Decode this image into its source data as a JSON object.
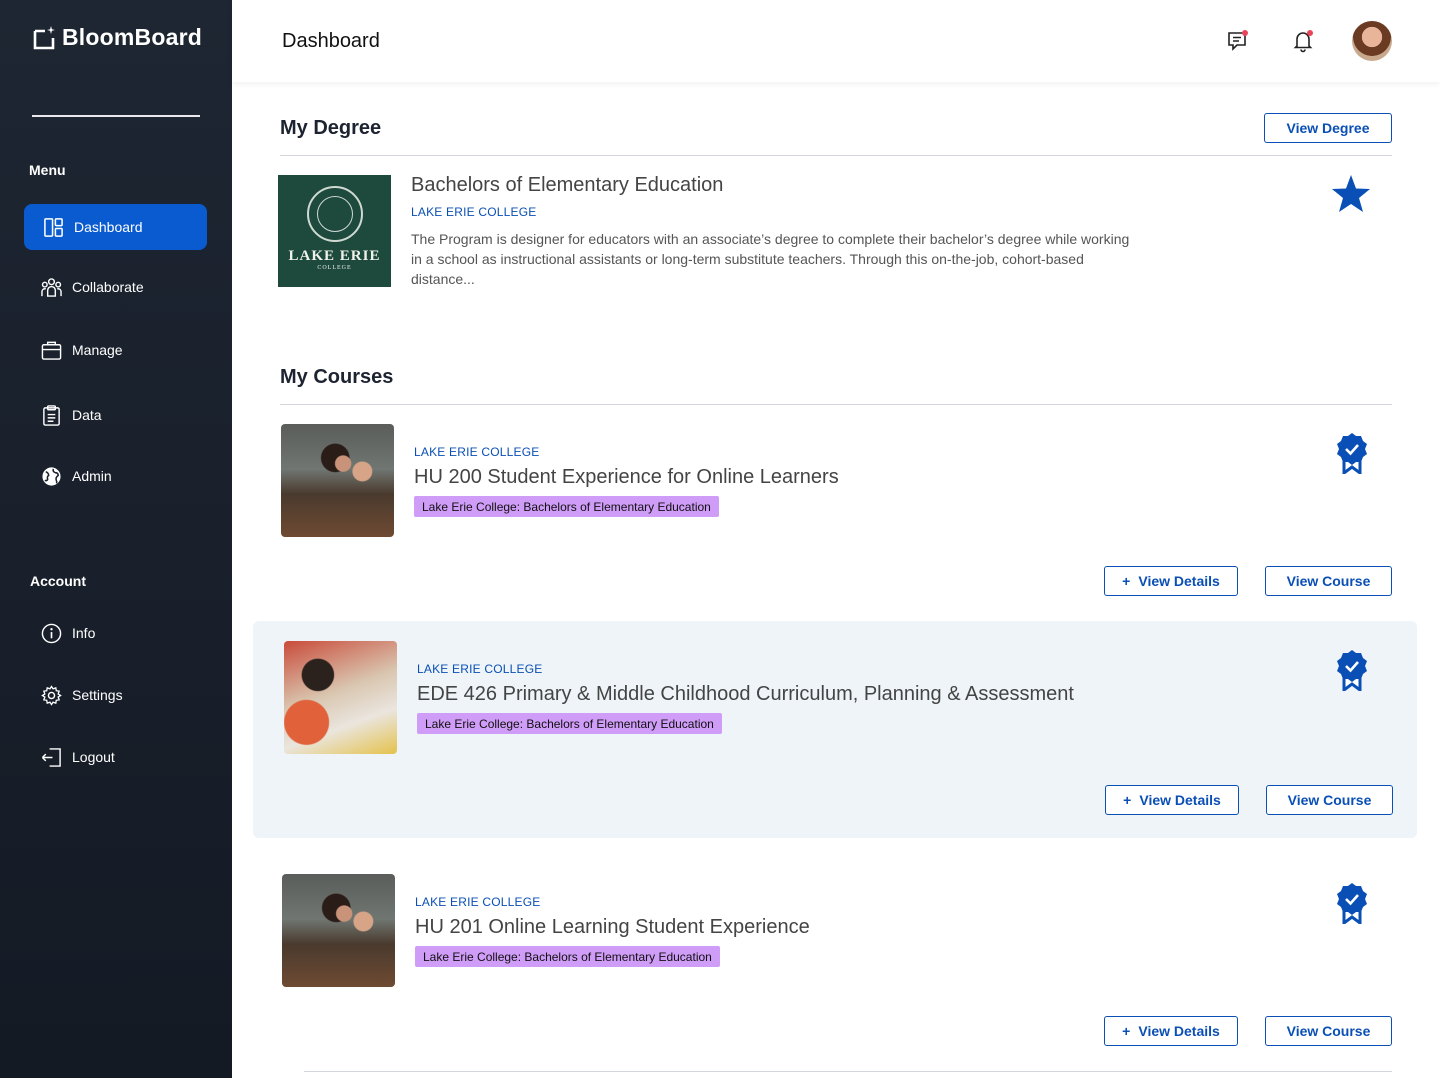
{
  "brand": {
    "name": "BloomBoard"
  },
  "header": {
    "title": "Dashboard",
    "messages_icon": "message-icon",
    "notifications_icon": "bell-icon"
  },
  "sidebar": {
    "menu_label": "Menu",
    "menu_items": [
      {
        "label": "Dashboard",
        "icon": "dashboard-icon",
        "active": true
      },
      {
        "label": "Collaborate",
        "icon": "people-icon"
      },
      {
        "label": "Manage",
        "icon": "briefcase-icon"
      },
      {
        "label": "Data",
        "icon": "clipboard-icon"
      },
      {
        "label": "Admin",
        "icon": "globe-icon"
      }
    ],
    "account_label": "Account",
    "account_items": [
      {
        "label": "Info",
        "icon": "info-icon"
      },
      {
        "label": "Settings",
        "icon": "gear-icon"
      },
      {
        "label": "Logout",
        "icon": "logout-icon"
      }
    ]
  },
  "degree": {
    "section_title": "My Degree",
    "view_button": "View Degree",
    "title": "Bachelors of Elementary Education",
    "college": "LAKE ERIE COLLEGE",
    "description": "The Program is designer for educators with an associate’s degree to complete their bachelor’s degree while working in a school as instructional assistants or long-term substitute teachers. Through this on-the-job, cohort-based distance...",
    "thumb_name": "LAKE ERIE",
    "thumb_sub": "COLLEGE"
  },
  "courses": {
    "section_title": "My Courses",
    "details_button": "View Details",
    "course_button": "View Course",
    "plus": "+",
    "items": [
      {
        "college": "LAKE ERIE COLLEGE",
        "title": "HU 200 Student Experience for Online Learners",
        "tag": "Lake Erie College: Bachelors of Elementary Education"
      },
      {
        "college": "LAKE ERIE COLLEGE",
        "title": "EDE 426 Primary & Middle Childhood Curriculum,  Planning & Assessment",
        "tag": "Lake Erie College: Bachelors of Elementary Education"
      },
      {
        "college": "LAKE ERIE COLLEGE",
        "title": "HU 201 Online Learning Student Experience",
        "tag": "Lake Erie College: Bachelors of Elementary Education"
      }
    ]
  },
  "colors": {
    "accent": "#0a4fb5",
    "active_nav": "#0a5bd0",
    "tag": "#cf9cf7",
    "highlight": "#eef4f8"
  }
}
